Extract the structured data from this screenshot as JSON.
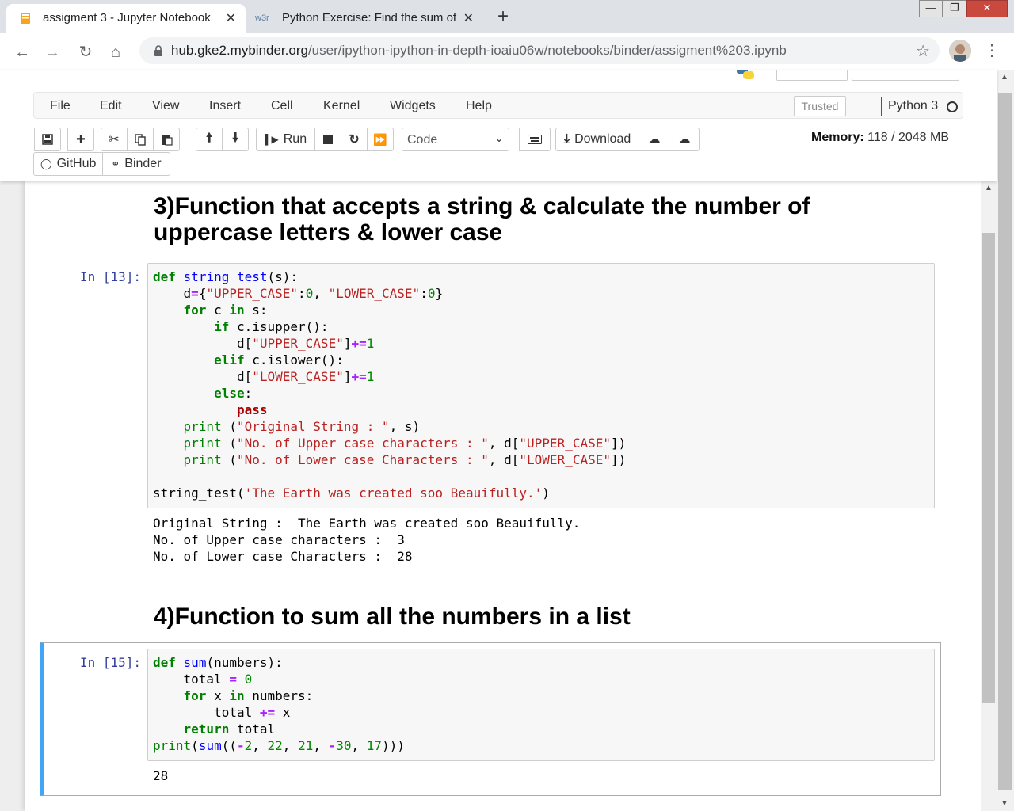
{
  "browser": {
    "tabs": [
      {
        "title": "assigment 3 - Jupyter Notebook",
        "favicon": "jupyter-notebook-icon",
        "close": "✕"
      },
      {
        "title": "Python Exercise: Find the sum of",
        "favicon_text": "w3r",
        "close": "✕"
      }
    ],
    "new_tab": "+",
    "url_host": "hub.gke2.mybinder.org",
    "url_path": "/user/ipython-ipython-in-depth-ioaiu06w/notebooks/binder/assigment%203.ipynb",
    "window_controls": {
      "minimize": "—",
      "restore": "❐",
      "close": "✕"
    }
  },
  "jupyter": {
    "menu": [
      "File",
      "Edit",
      "View",
      "Insert",
      "Cell",
      "Kernel",
      "Widgets",
      "Help"
    ],
    "trusted": "Trusted",
    "kernel_name": "Python 3",
    "toolbar": {
      "run_label": "Run",
      "cell_type": "Code",
      "download_label": "Download",
      "github_label": "GitHub",
      "binder_label": "Binder"
    },
    "memory_label": "Memory:",
    "memory_value": "118 / 2048 MB"
  },
  "notebook": {
    "heading3_line1": "3)Function that accepts a string & calculate the number of",
    "heading3_line2": "uppercase letters & lower case",
    "cell13_prompt": "In [13]:",
    "cell13_output": "Original String :  The Earth was created soo Beauifully.\nNo. of Upper case characters :  3\nNo. of Lower case Characters :  28",
    "heading4": "4)Function to sum all the numbers in a list",
    "cell15_prompt": "In [15]:",
    "cell15_output": "28"
  },
  "colors": {
    "accent_selected_cell": "#42a5f5",
    "prompt": "#303f9f",
    "jupyter_orange": "#f37726"
  }
}
